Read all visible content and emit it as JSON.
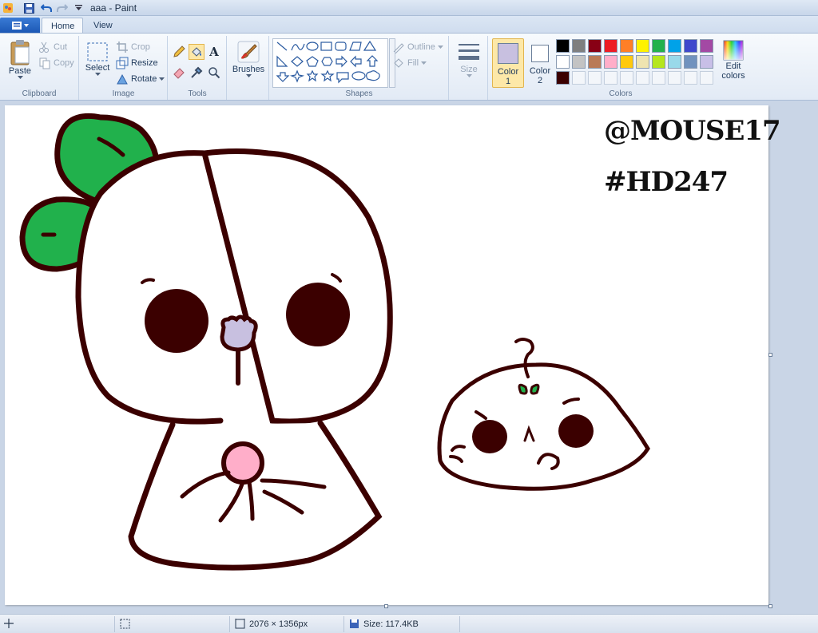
{
  "window": {
    "title": "aaa - Paint"
  },
  "tabs": [
    {
      "label": "Home",
      "active": true
    },
    {
      "label": "View",
      "active": false
    }
  ],
  "clipboard": {
    "paste": "Paste",
    "cut": "Cut",
    "copy": "Copy",
    "group": "Clipboard"
  },
  "image": {
    "select": "Select",
    "crop": "Crop",
    "resize": "Resize",
    "rotate": "Rotate",
    "group": "Image"
  },
  "tools": {
    "group": "Tools",
    "text_icon": "A"
  },
  "brushes": {
    "label": "Brushes"
  },
  "shapes": {
    "outline": "Outline",
    "fill": "Fill",
    "group": "Shapes"
  },
  "size": {
    "label": "Size"
  },
  "colors": {
    "color1_label": "Color",
    "color1_num": "1",
    "color2_label": "Color",
    "color2_num": "2",
    "edit_label": "Edit",
    "edit_label2": "colors",
    "group": "Colors",
    "color1": "#c8c0e0",
    "color2": "#ffffff",
    "row1": [
      "#000000",
      "#7f7f7f",
      "#880015",
      "#ed1c24",
      "#ff7f27",
      "#fff200",
      "#22b14c",
      "#00a2e8",
      "#3f48cc",
      "#a349a4"
    ],
    "row2": [
      "#ffffff",
      "#c3c3c3",
      "#b97a57",
      "#ffaec9",
      "#ffc90e",
      "#efe4b0",
      "#b5e61d",
      "#99d9ea",
      "#7092be",
      "#c8bfe7"
    ],
    "row3": [
      "#3b0000"
    ]
  },
  "canvas": {
    "watermark_1": "@MOUSE17",
    "watermark_2": "#HD247"
  },
  "status": {
    "dimensions": "2076 × 1356px",
    "size": "Size: 117.4KB"
  }
}
